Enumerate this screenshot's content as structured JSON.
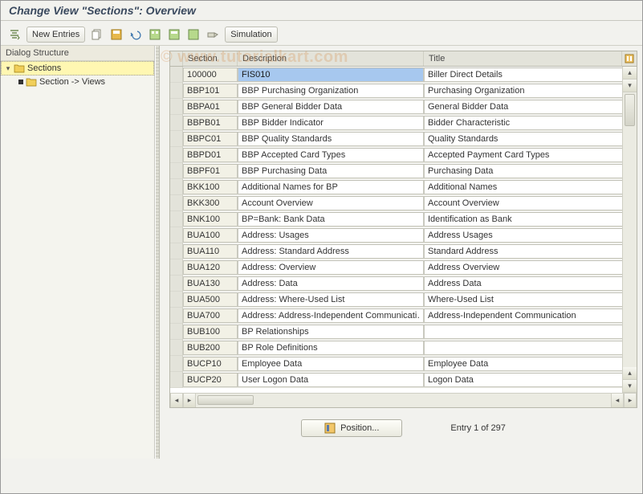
{
  "title": "Change View \"Sections\": Overview",
  "watermark": "© www.tutorialkart.com",
  "toolbar": {
    "new_entries": "New Entries",
    "simulation": "Simulation"
  },
  "sidebar": {
    "header": "Dialog Structure",
    "root": "Sections",
    "child": "Section -> Views"
  },
  "table": {
    "headers": {
      "section": "Section",
      "description": "Description",
      "title": "Title"
    },
    "rows": [
      {
        "section": "100000",
        "description": "FIS010",
        "title": "Biller Direct Details"
      },
      {
        "section": "BBP101",
        "description": "BBP Purchasing Organization",
        "title": "Purchasing Organization"
      },
      {
        "section": "BBPA01",
        "description": "BBP General Bidder Data",
        "title": "General Bidder Data"
      },
      {
        "section": "BBPB01",
        "description": "BBP Bidder Indicator",
        "title": "Bidder Characteristic"
      },
      {
        "section": "BBPC01",
        "description": "BBP Quality Standards",
        "title": "Quality Standards"
      },
      {
        "section": "BBPD01",
        "description": "BBP Accepted Card Types",
        "title": "Accepted Payment Card Types"
      },
      {
        "section": "BBPF01",
        "description": "BBP Purchasing Data",
        "title": "Purchasing Data"
      },
      {
        "section": "BKK100",
        "description": "Additional Names for BP",
        "title": "Additional Names"
      },
      {
        "section": "BKK300",
        "description": "Account Overview",
        "title": "Account Overview"
      },
      {
        "section": "BNK100",
        "description": "BP=Bank: Bank Data",
        "title": "Identification as Bank"
      },
      {
        "section": "BUA100",
        "description": "Address: Usages",
        "title": "Address Usages"
      },
      {
        "section": "BUA110",
        "description": "Address: Standard Address",
        "title": "Standard Address"
      },
      {
        "section": "BUA120",
        "description": "Address: Overview",
        "title": "Address Overview"
      },
      {
        "section": "BUA130",
        "description": "Address: Data",
        "title": "Address Data"
      },
      {
        "section": "BUA500",
        "description": "Address: Where-Used List",
        "title": "Where-Used List"
      },
      {
        "section": "BUA700",
        "description": "Address: Address-Independent Communicati…",
        "title": "Address-Independent Communication"
      },
      {
        "section": "BUB100",
        "description": "BP Relationships",
        "title": ""
      },
      {
        "section": "BUB200",
        "description": "BP Role Definitions",
        "title": ""
      },
      {
        "section": "BUCP10",
        "description": "Employee Data",
        "title": "Employee Data"
      },
      {
        "section": "BUCP20",
        "description": "User Logon Data",
        "title": "Logon Data"
      }
    ]
  },
  "footer": {
    "position": "Position...",
    "entry_text": "Entry 1 of 297"
  }
}
